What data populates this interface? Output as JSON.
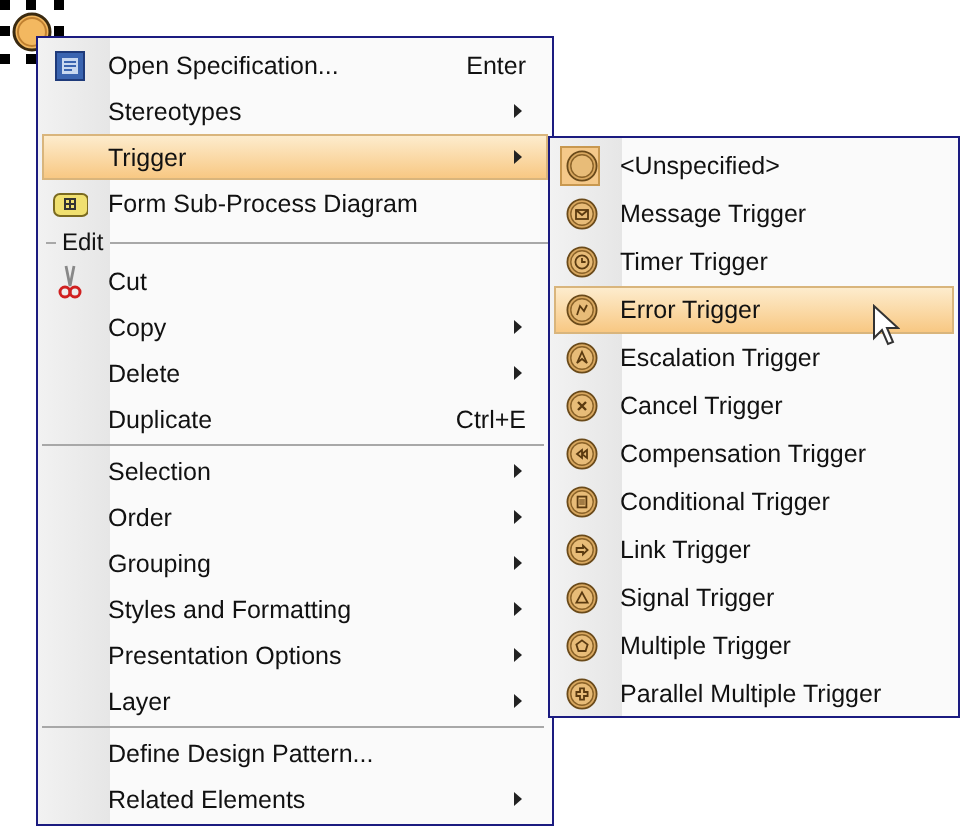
{
  "context_menu": {
    "items": [
      {
        "kind": "item",
        "label": "Open Specification...",
        "shortcut": "Enter",
        "submenu": false,
        "selected": false
      },
      {
        "kind": "item",
        "label": "Stereotypes",
        "submenu": true,
        "selected": false
      },
      {
        "kind": "item",
        "label": "Trigger",
        "submenu": true,
        "selected": true
      },
      {
        "kind": "item",
        "label": "Form Sub-Process Diagram",
        "submenu": false,
        "selected": false
      },
      {
        "kind": "section",
        "label": "Edit"
      },
      {
        "kind": "item",
        "label": "Cut",
        "submenu": false,
        "selected": false
      },
      {
        "kind": "item",
        "label": "Copy",
        "submenu": true,
        "selected": false
      },
      {
        "kind": "item",
        "label": "Delete",
        "submenu": true,
        "selected": false
      },
      {
        "kind": "item",
        "label": "Duplicate",
        "shortcut": "Ctrl+E",
        "submenu": false,
        "selected": false
      },
      {
        "kind": "separator"
      },
      {
        "kind": "item",
        "label": "Selection",
        "submenu": true,
        "selected": false
      },
      {
        "kind": "item",
        "label": "Order",
        "submenu": true,
        "selected": false
      },
      {
        "kind": "item",
        "label": "Grouping",
        "submenu": true,
        "selected": false
      },
      {
        "kind": "item",
        "label": "Styles and Formatting",
        "submenu": true,
        "selected": false
      },
      {
        "kind": "item",
        "label": "Presentation Options",
        "submenu": true,
        "selected": false
      },
      {
        "kind": "item",
        "label": "Layer",
        "submenu": true,
        "selected": false
      },
      {
        "kind": "separator"
      },
      {
        "kind": "item",
        "label": "Define Design Pattern...",
        "submenu": false,
        "selected": false
      },
      {
        "kind": "item",
        "label": "Related Elements",
        "submenu": true,
        "selected": false
      }
    ]
  },
  "trigger_submenu": {
    "items": [
      {
        "label": "<Unspecified>",
        "checked": true,
        "selected": false
      },
      {
        "label": "Message Trigger",
        "checked": false,
        "selected": false
      },
      {
        "label": "Timer Trigger",
        "checked": false,
        "selected": false
      },
      {
        "label": "Error Trigger",
        "checked": false,
        "selected": true
      },
      {
        "label": "Escalation Trigger",
        "checked": false,
        "selected": false
      },
      {
        "label": "Cancel Trigger",
        "checked": false,
        "selected": false
      },
      {
        "label": "Compensation Trigger",
        "checked": false,
        "selected": false
      },
      {
        "label": "Conditional Trigger",
        "checked": false,
        "selected": false
      },
      {
        "label": "Link Trigger",
        "checked": false,
        "selected": false
      },
      {
        "label": "Signal Trigger",
        "checked": false,
        "selected": false
      },
      {
        "label": "Multiple Trigger",
        "checked": false,
        "selected": false
      },
      {
        "label": "Parallel Multiple Trigger",
        "checked": false,
        "selected": false
      }
    ]
  }
}
